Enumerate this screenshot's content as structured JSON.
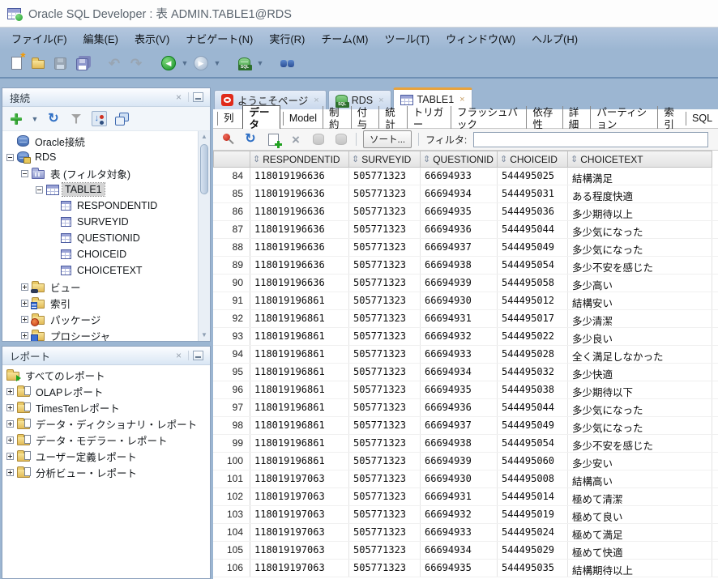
{
  "window": {
    "title": "Oracle SQL Developer : 表 ADMIN.TABLE1@RDS"
  },
  "menubar": {
    "items": [
      "ファイル(F)",
      "編集(E)",
      "表示(V)",
      "ナビゲート(N)",
      "実行(R)",
      "チーム(M)",
      "ツール(T)",
      "ウィンドウ(W)",
      "ヘルプ(H)"
    ]
  },
  "icons": {
    "app": "sql-developer-table-logo",
    "sort_indicator": "⇕",
    "expander_collapsed": "+",
    "expander_expanded": "-",
    "tab_close": "×",
    "scroll_up": "▲",
    "scroll_down": "▼",
    "back_arrow": "◀",
    "forward_arrow": "▶",
    "caret": "▼",
    "undo": "↶",
    "redo": "↷",
    "refresh": "↻",
    "delete": "×"
  },
  "colors": {
    "chrome_blue": "#9cb6d2",
    "active_tab_accent": "#e9a33c",
    "tree_selection": "#d4d4d4",
    "grid_header_bg": "#ececec",
    "oracle_red": "#e02a1a"
  },
  "connections_panel": {
    "title": "接続",
    "tree": [
      {
        "label": "Oracle接続",
        "icon": "db",
        "level": 0
      },
      {
        "label": "RDS",
        "icon": "db-conn",
        "level": 0,
        "expand": "minus"
      },
      {
        "label": "表 (フィルタ対象)",
        "icon": "folder-blue",
        "level": 1,
        "expand": "minus"
      },
      {
        "label": "TABLE1",
        "icon": "table",
        "level": 2,
        "expand": "minus",
        "selected": true
      },
      {
        "label": "RESPONDENTID",
        "icon": "column",
        "level": 3
      },
      {
        "label": "SURVEYID",
        "icon": "column",
        "level": 3
      },
      {
        "label": "QUESTIONID",
        "icon": "column",
        "level": 3
      },
      {
        "label": "CHOICEID",
        "icon": "column",
        "level": 3
      },
      {
        "label": "CHOICETEXT",
        "icon": "column",
        "level": 3
      },
      {
        "label": "ビュー",
        "icon": "folder-view",
        "level": 1,
        "expand": "plus"
      },
      {
        "label": "索引",
        "icon": "folder-index",
        "level": 1,
        "expand": "plus"
      },
      {
        "label": "パッケージ",
        "icon": "folder-package",
        "level": 1,
        "expand": "plus"
      },
      {
        "label": "プロシージャ",
        "icon": "folder-proc",
        "level": 1,
        "expand": "plus"
      }
    ]
  },
  "reports_panel": {
    "title": "レポート",
    "tree": [
      {
        "label": "すべてのレポート",
        "icon": "reports-root",
        "level": 0,
        "noexp": true
      },
      {
        "label": "OLAPレポート",
        "icon": "folder-report",
        "level": 0,
        "expand": "plus"
      },
      {
        "label": "TimesTenレポート",
        "icon": "folder-report",
        "level": 0,
        "expand": "plus"
      },
      {
        "label": "データ・ディクショナリ・レポート",
        "icon": "folder-report",
        "level": 0,
        "expand": "plus"
      },
      {
        "label": "データ・モデラー・レポート",
        "icon": "folder-report",
        "level": 0,
        "expand": "plus"
      },
      {
        "label": "ユーザー定義レポート",
        "icon": "folder-report",
        "level": 0,
        "expand": "plus"
      },
      {
        "label": "分析ビュー・レポート",
        "icon": "folder-report",
        "level": 0,
        "expand": "plus"
      }
    ]
  },
  "editor_tabs": [
    {
      "label": "ようこそページ",
      "icon": "oracle"
    },
    {
      "label": "RDS",
      "icon": "sql"
    },
    {
      "label": "TABLE1",
      "icon": "table",
      "active": true
    }
  ],
  "detail_tabs": [
    {
      "label": "列"
    },
    {
      "label": "データ",
      "active": true
    },
    {
      "label": "Model"
    },
    {
      "label": "制約"
    },
    {
      "label": "付与"
    },
    {
      "label": "統計"
    },
    {
      "label": "トリガー"
    },
    {
      "label": "フラッシュバック"
    },
    {
      "label": "依存性"
    },
    {
      "label": "詳細"
    },
    {
      "label": "パーティション"
    },
    {
      "label": "索引"
    },
    {
      "label": "SQL"
    }
  ],
  "data_toolbar": {
    "sort_label": "ソート...",
    "filter_label": "フィルタ:",
    "filter_value": ""
  },
  "grid": {
    "columns": [
      "RESPONDENTID",
      "SURVEYID",
      "QUESTIONID",
      "CHOICEID",
      "CHOICETEXT"
    ],
    "rows": [
      {
        "n": "84",
        "r": "118019196636",
        "s": "505771323",
        "q": "66694933",
        "c": "544495025",
        "t": "結構満足"
      },
      {
        "n": "85",
        "r": "118019196636",
        "s": "505771323",
        "q": "66694934",
        "c": "544495031",
        "t": "ある程度快適"
      },
      {
        "n": "86",
        "r": "118019196636",
        "s": "505771323",
        "q": "66694935",
        "c": "544495036",
        "t": "多少期待以上"
      },
      {
        "n": "87",
        "r": "118019196636",
        "s": "505771323",
        "q": "66694936",
        "c": "544495044",
        "t": "多少気になった"
      },
      {
        "n": "88",
        "r": "118019196636",
        "s": "505771323",
        "q": "66694937",
        "c": "544495049",
        "t": "多少気になった"
      },
      {
        "n": "89",
        "r": "118019196636",
        "s": "505771323",
        "q": "66694938",
        "c": "544495054",
        "t": "多少不安を感じた"
      },
      {
        "n": "90",
        "r": "118019196636",
        "s": "505771323",
        "q": "66694939",
        "c": "544495058",
        "t": "多少高い"
      },
      {
        "n": "91",
        "r": "118019196861",
        "s": "505771323",
        "q": "66694930",
        "c": "544495012",
        "t": "結構安い"
      },
      {
        "n": "92",
        "r": "118019196861",
        "s": "505771323",
        "q": "66694931",
        "c": "544495017",
        "t": "多少清潔"
      },
      {
        "n": "93",
        "r": "118019196861",
        "s": "505771323",
        "q": "66694932",
        "c": "544495022",
        "t": "多少良い"
      },
      {
        "n": "94",
        "r": "118019196861",
        "s": "505771323",
        "q": "66694933",
        "c": "544495028",
        "t": "全く満足しなかった"
      },
      {
        "n": "95",
        "r": "118019196861",
        "s": "505771323",
        "q": "66694934",
        "c": "544495032",
        "t": "多少快適"
      },
      {
        "n": "96",
        "r": "118019196861",
        "s": "505771323",
        "q": "66694935",
        "c": "544495038",
        "t": "多少期待以下"
      },
      {
        "n": "97",
        "r": "118019196861",
        "s": "505771323",
        "q": "66694936",
        "c": "544495044",
        "t": "多少気になった"
      },
      {
        "n": "98",
        "r": "118019196861",
        "s": "505771323",
        "q": "66694937",
        "c": "544495049",
        "t": "多少気になった"
      },
      {
        "n": "99",
        "r": "118019196861",
        "s": "505771323",
        "q": "66694938",
        "c": "544495054",
        "t": "多少不安を感じた"
      },
      {
        "n": "100",
        "r": "118019196861",
        "s": "505771323",
        "q": "66694939",
        "c": "544495060",
        "t": "多少安い"
      },
      {
        "n": "101",
        "r": "118019197063",
        "s": "505771323",
        "q": "66694930",
        "c": "544495008",
        "t": "結構高い"
      },
      {
        "n": "102",
        "r": "118019197063",
        "s": "505771323",
        "q": "66694931",
        "c": "544495014",
        "t": "極めて清潔"
      },
      {
        "n": "103",
        "r": "118019197063",
        "s": "505771323",
        "q": "66694932",
        "c": "544495019",
        "t": "極めて良い"
      },
      {
        "n": "104",
        "r": "118019197063",
        "s": "505771323",
        "q": "66694933",
        "c": "544495024",
        "t": "極めて満足"
      },
      {
        "n": "105",
        "r": "118019197063",
        "s": "505771323",
        "q": "66694934",
        "c": "544495029",
        "t": "極めて快適"
      },
      {
        "n": "106",
        "r": "118019197063",
        "s": "505771323",
        "q": "66694935",
        "c": "544495035",
        "t": "結構期待以上"
      }
    ]
  }
}
